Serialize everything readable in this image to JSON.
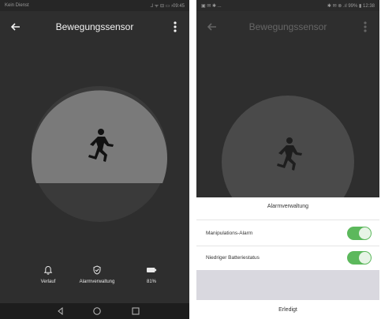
{
  "left": {
    "status": {
      "carrier": "Kein Dienst",
      "right": "⅃  ᯤ  ⊟ ▭ ›09:45"
    },
    "title": "Bewegungssensor",
    "nav": {
      "history": "Verlauf",
      "alarm": "Alarmverwaltung",
      "battery": "81%"
    }
  },
  "right": {
    "status": {
      "left": "▣ ✉ ✱ ...",
      "right": "✱ ✉ ⊗ .ıl 99% ▮ 12:38"
    },
    "title": "Bewegungssensor",
    "sheet": {
      "title": "Alarmverwaltung",
      "rows": [
        {
          "label": "Manipulations-Alarm",
          "on": true
        },
        {
          "label": "Niedriger Batteriestatus",
          "on": true
        }
      ],
      "done": "Erledigt"
    }
  },
  "colors": {
    "toggle": "#5cb85c",
    "bg": "#2e2e2e",
    "circle": "#7a7a7a"
  }
}
